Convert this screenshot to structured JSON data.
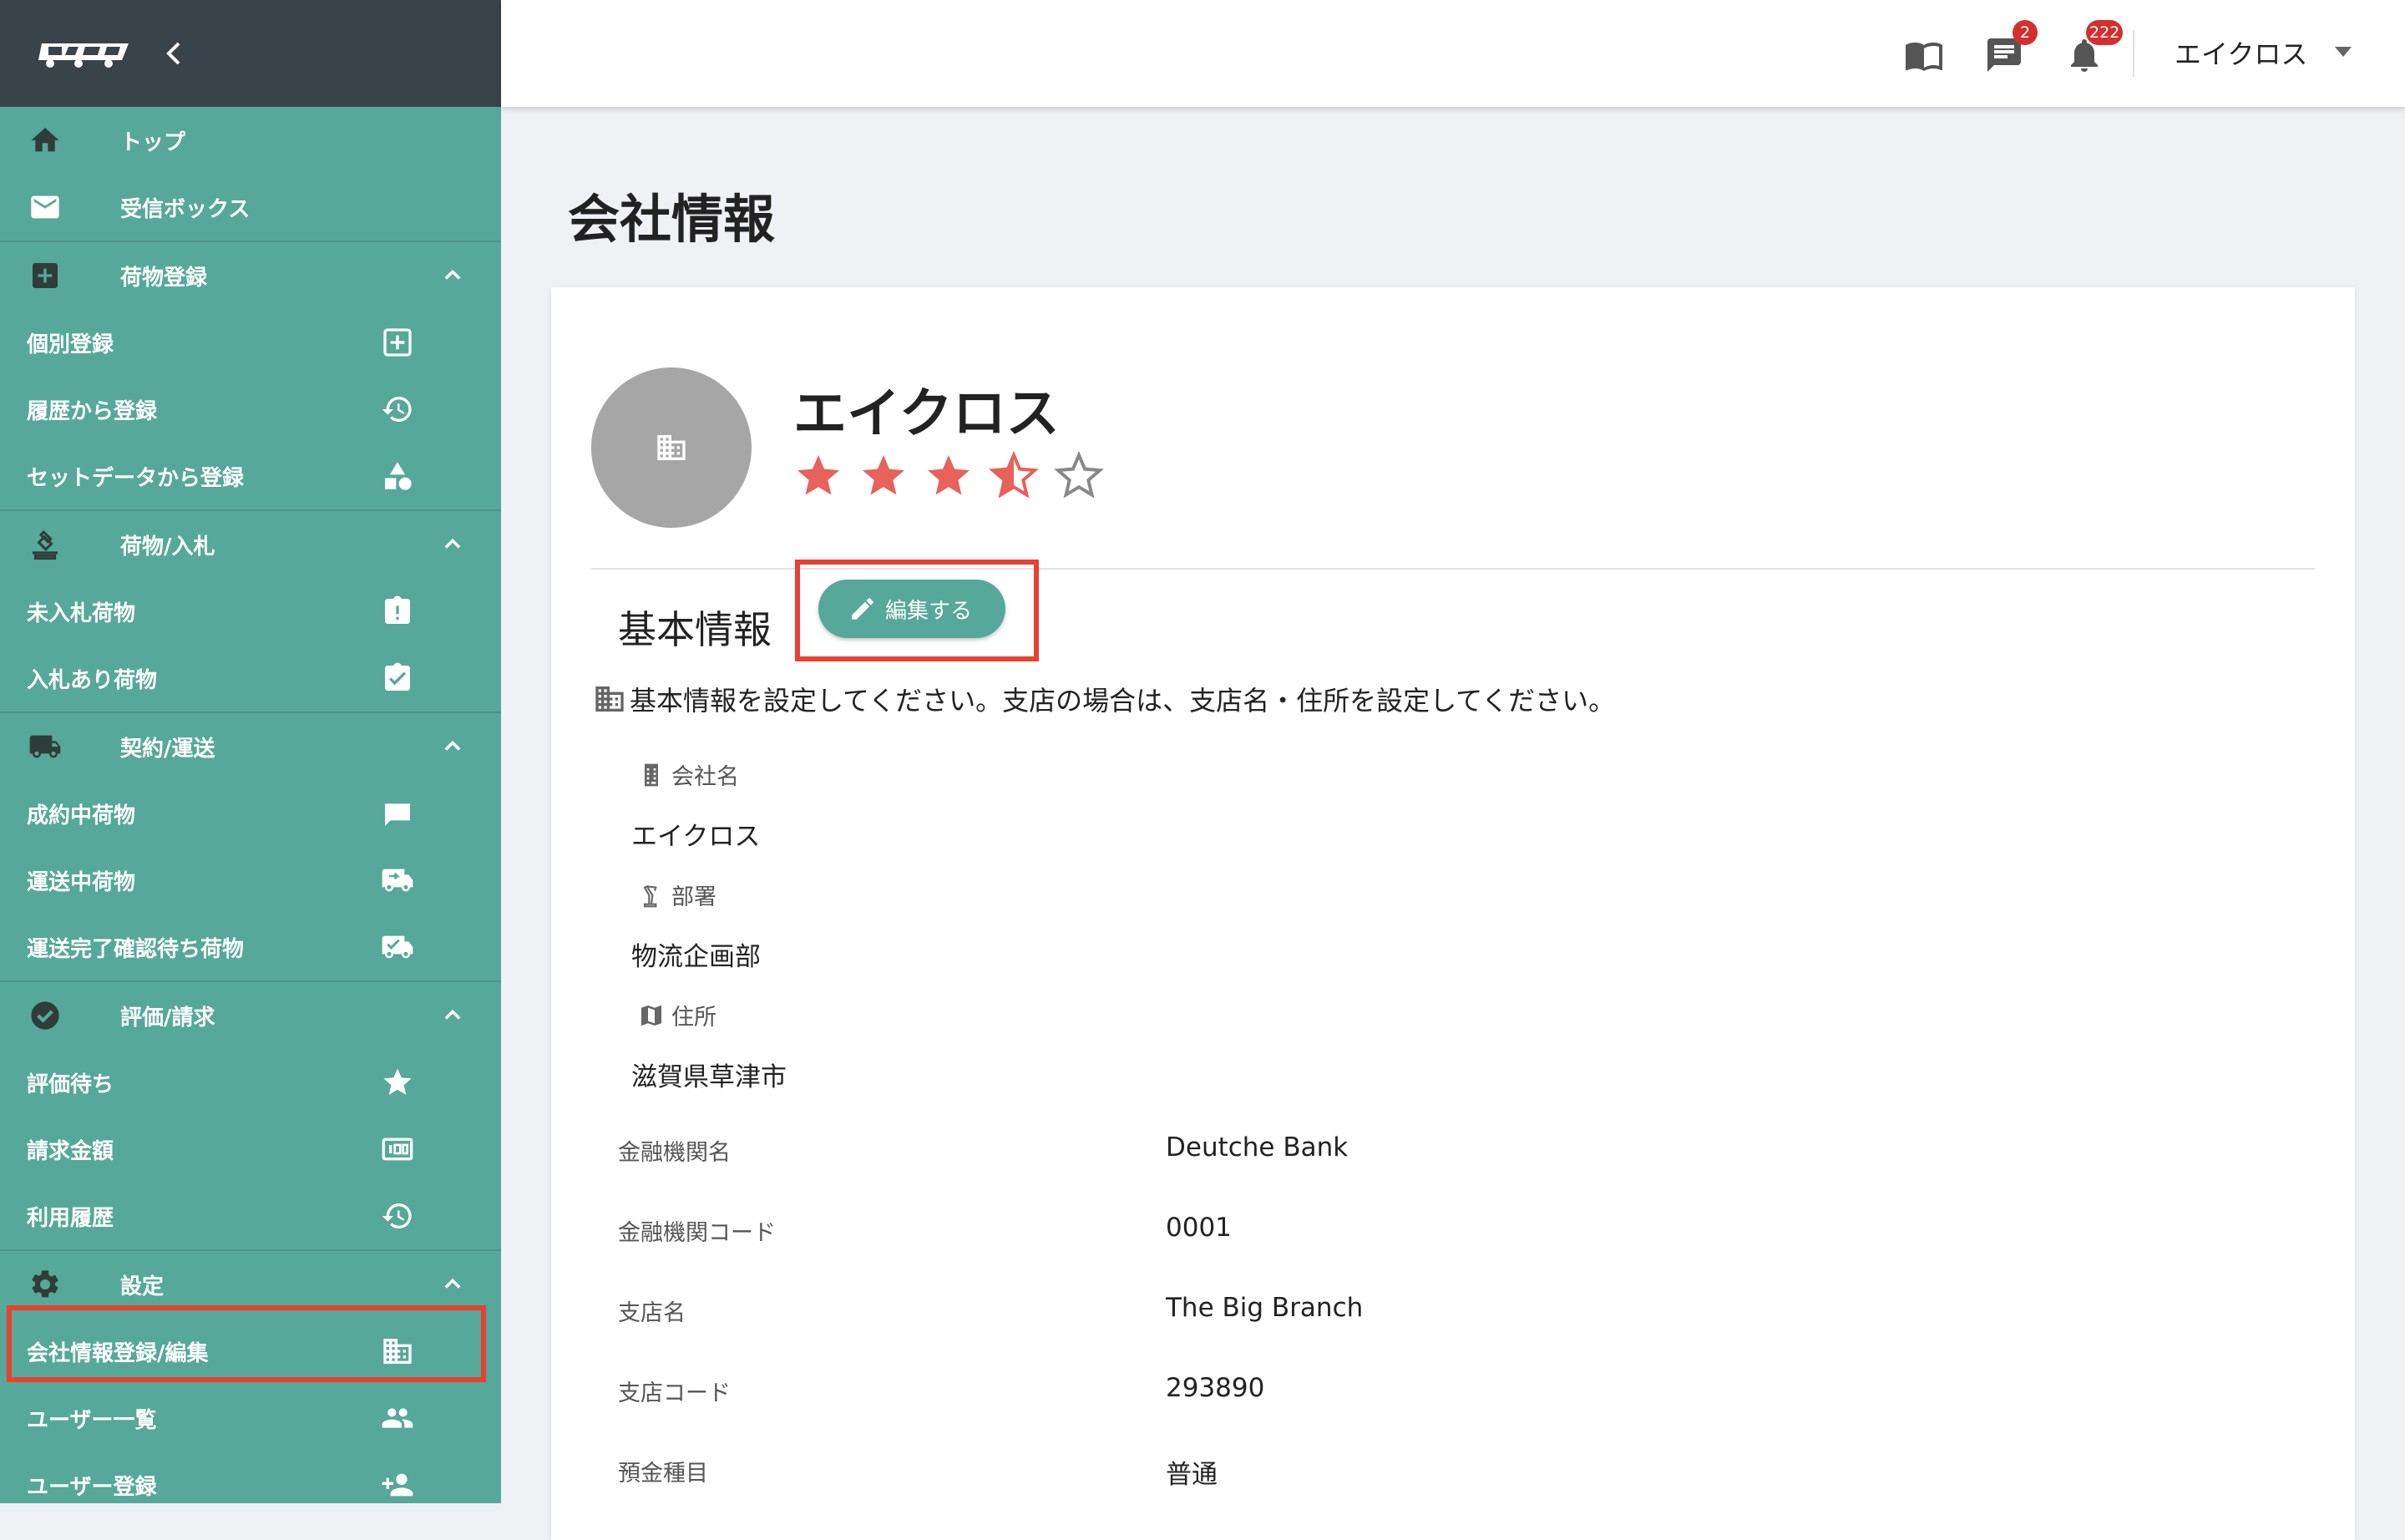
{
  "sidebar": {
    "items": [
      {
        "label": "トップ"
      },
      {
        "label": "受信ボックス"
      },
      {
        "label": "荷物登録"
      },
      {
        "label": "個別登録"
      },
      {
        "label": "履歴から登録"
      },
      {
        "label": "セットデータから登録"
      },
      {
        "label": "荷物/入札"
      },
      {
        "label": "未入札荷物"
      },
      {
        "label": "入札あり荷物"
      },
      {
        "label": "契約/運送"
      },
      {
        "label": "成約中荷物"
      },
      {
        "label": "運送中荷物"
      },
      {
        "label": "運送完了確認待ち荷物"
      },
      {
        "label": "評価/請求"
      },
      {
        "label": "評価待ち"
      },
      {
        "label": "請求金額"
      },
      {
        "label": "利用履歴"
      },
      {
        "label": "設定"
      },
      {
        "label": "会社情報登録/編集"
      },
      {
        "label": "ユーザー一覧"
      },
      {
        "label": "ユーザー登録"
      }
    ],
    "selected": "会社情報登録/編集"
  },
  "topbar": {
    "messages_badge": "2",
    "notifications_badge": "222",
    "user_name": "エイクロス"
  },
  "main": {
    "page_title": "会社情報",
    "company_name": "エイクロス",
    "rating": 3.5,
    "rating_max": 5,
    "section_title": "基本情報",
    "edit_button": "編集する",
    "info_text": "基本情報を設定してください。支店の場合は、支店名・住所を設定してください。",
    "fields": [
      {
        "label": "会社名",
        "value": "エイクロス",
        "icon": "building-icon"
      },
      {
        "label": "部署",
        "value": "物流企画部",
        "icon": "desk-lamp-icon"
      },
      {
        "label": "住所",
        "value": "滋賀県草津市",
        "icon": "map-icon"
      }
    ],
    "bank": [
      {
        "label": "金融機関名",
        "value": "Deutche Bank"
      },
      {
        "label": "金融機関コード",
        "value": "0001"
      },
      {
        "label": "支店名",
        "value": "The Big Branch"
      },
      {
        "label": "支店コード",
        "value": "293890"
      },
      {
        "label": "預金種目",
        "value": "普通"
      }
    ]
  },
  "colors": {
    "sidebar": "#56a89a",
    "sidebar_header": "#39434a",
    "accent_highlight": "#e8412f",
    "star": "#e8615a",
    "badge": "#d32f2f"
  }
}
